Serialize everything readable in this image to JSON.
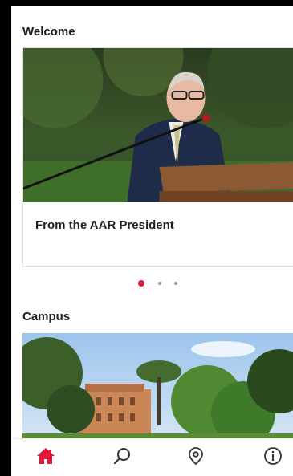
{
  "welcome": {
    "title": "Welcome",
    "card_caption": "From the AAR President"
  },
  "pager": {
    "count": 3,
    "active_index": 0
  },
  "campus": {
    "title": "Campus"
  },
  "tabs": [
    {
      "icon": "home-icon",
      "active": true
    },
    {
      "icon": "search-icon",
      "active": false
    },
    {
      "icon": "map-pin-icon",
      "active": false
    },
    {
      "icon": "info-icon",
      "active": false
    }
  ],
  "colors": {
    "accent": "#e0173a",
    "icon_inactive": "#333333"
  }
}
